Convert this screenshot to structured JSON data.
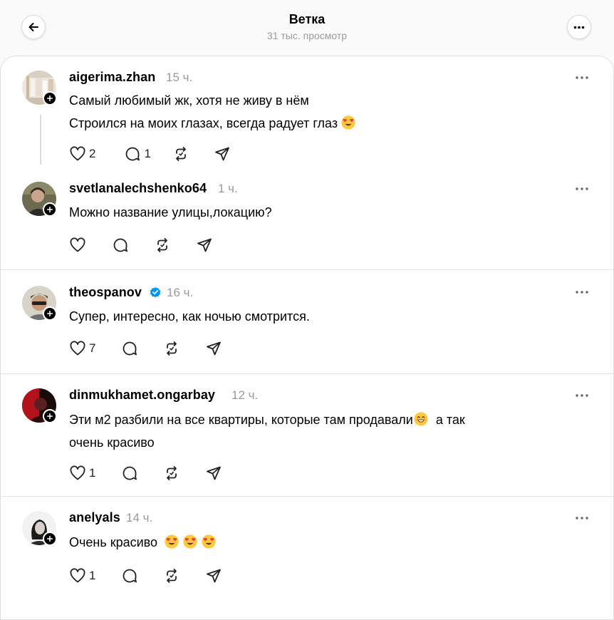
{
  "header": {
    "title": "Ветка",
    "views": "31 тыс. просмотр"
  },
  "posts": [
    {
      "username": "aigerima.zhan",
      "time": "15 ч.",
      "lines": [
        "Самый любимый жк, хотя не живу в нём",
        "Строился на моих глазах, всегда радует глаз"
      ],
      "likes": "2",
      "replies": "1"
    },
    {
      "username": "svetlanalechshenko64",
      "time": "1 ч.",
      "lines": [
        "Можно название улицы,локацию?"
      ],
      "likes": "",
      "replies": ""
    },
    {
      "username": "theospanov",
      "time": "16 ч.",
      "lines": [
        "Супер, интересно, как ночью смотрится."
      ],
      "likes": "7",
      "replies": "",
      "verified": true
    },
    {
      "username": "dinmukhamet.ongarbay",
      "time": "12 ч.",
      "lines": [
        "Эти м2 разбили на все квартиры, которые там продавали",
        "очень красиво"
      ],
      "line1_tail": "а так",
      "likes": "1",
      "replies": ""
    },
    {
      "username": "anelyals",
      "time": "14 ч.",
      "lines": [
        "Очень красиво"
      ],
      "likes": "1",
      "replies": ""
    }
  ],
  "icons": {
    "back": "arrow-left-icon",
    "more": "more-horizontal-icon",
    "like": "heart-icon",
    "reply": "comment-icon",
    "repost": "repost-icon",
    "share": "send-icon",
    "follow": "plus-icon",
    "verified": "verified-badge-icon"
  },
  "colors": {
    "verified": "#0095f6",
    "muted": "#9a9a9a"
  }
}
